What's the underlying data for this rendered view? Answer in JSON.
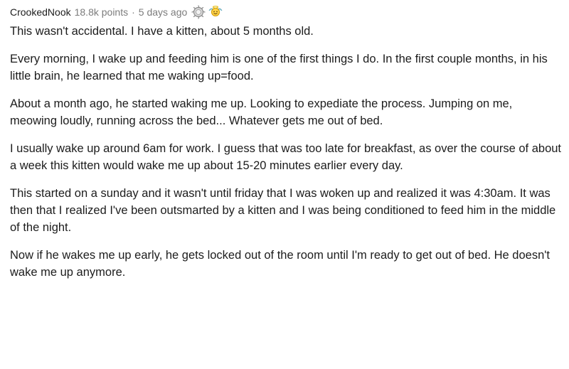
{
  "comment": {
    "author": "CrookedNook",
    "points": "18.8k points",
    "separator": "·",
    "time": "5 days ago",
    "awards": [
      {
        "icon": "silver-award-icon"
      },
      {
        "icon": "wholesome-award-icon"
      }
    ],
    "paragraphs": [
      "This wasn't accidental. I have a kitten, about 5 months old.",
      "Every morning, I wake up and feeding him is one of the first things I do. In the first couple months, in his little brain, he learned that me waking up=food.",
      "About a month ago, he started waking me up. Looking to expediate the process. Jumping on me, meowing loudly, running across the bed... Whatever gets me out of bed.",
      "I usually wake up around 6am for work. I guess that was too late for breakfast, as over the course of about a week this kitten would wake me up about 15-20 minutes earlier every day.",
      "This started on a sunday and it wasn't until friday that I was woken up and realized it was 4:30am. It was then that I realized I've been outsmarted by a kitten and I was being conditioned to feed him in the middle of the night.",
      "Now if he wakes me up early, he gets locked out of the room until I'm ready to get out of bed. He doesn't wake me up anymore."
    ]
  }
}
